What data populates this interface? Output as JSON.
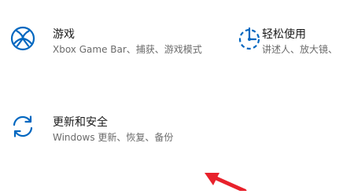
{
  "tiles": [
    {
      "title": "游戏",
      "description": "Xbox Game Bar、捕获、游戏模式",
      "icon": "xbox-icon"
    },
    {
      "title": "轻松使用",
      "description": "讲述人、放大镜、",
      "icon": "ease-of-access-icon"
    },
    {
      "title": "更新和安全",
      "description": "Windows 更新、恢复、备份",
      "icon": "update-sync-icon"
    }
  ],
  "colors": {
    "accent": "#0067c0",
    "arrow": "#e8212b",
    "title_text": "#1a1a1a",
    "description_text": "#6b6b6b"
  }
}
